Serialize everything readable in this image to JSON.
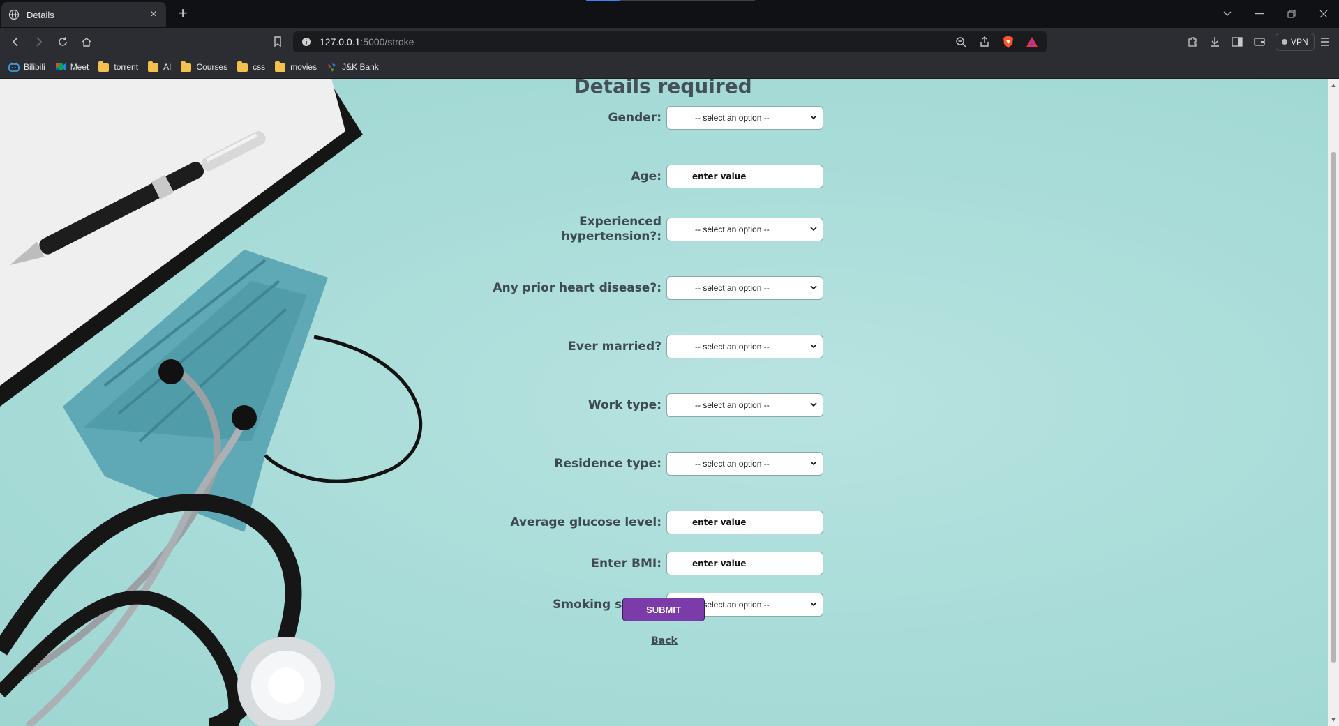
{
  "browser": {
    "tab_title": "Details",
    "url_host": "127.0.0.1",
    "url_path": ":5000/stroke",
    "vpn_label": "VPN",
    "bookmarks": [
      {
        "label": "Bilibili",
        "icon": "bilibili-icon"
      },
      {
        "label": "Meet",
        "icon": "meet-icon"
      },
      {
        "label": "torrent",
        "icon": "folder-icon"
      },
      {
        "label": "AI",
        "icon": "folder-icon"
      },
      {
        "label": "Courses",
        "icon": "folder-icon"
      },
      {
        "label": "css",
        "icon": "folder-icon"
      },
      {
        "label": "movies",
        "icon": "folder-icon"
      },
      {
        "label": "J&K Bank",
        "icon": "jk-bank-icon"
      }
    ]
  },
  "page": {
    "heading": "Details required",
    "fields": [
      {
        "label": "Gender:",
        "type": "select",
        "value": "-- select an option --"
      },
      {
        "label": "Age:",
        "type": "input",
        "placeholder": "enter value"
      },
      {
        "label": "Experienced hypertension?:",
        "type": "select",
        "value": "-- select an option --"
      },
      {
        "label": "Any prior heart disease?:",
        "type": "select",
        "value": "-- select an option --"
      },
      {
        "label": "Ever married?",
        "type": "select",
        "value": "-- select an option --"
      },
      {
        "label": "Work type:",
        "type": "select",
        "value": "-- select an option --"
      },
      {
        "label": "Residence type:",
        "type": "select",
        "value": "-- select an option --"
      },
      {
        "label": "Average glucose level:",
        "type": "input",
        "placeholder": "enter value"
      },
      {
        "label": "Enter BMI:",
        "type": "input",
        "placeholder": "enter value"
      },
      {
        "label": "Smoking status:",
        "type": "select",
        "value": "-- select an option --"
      }
    ],
    "submit_label": "SUBMIT",
    "back_label": "Back"
  },
  "colors": {
    "page_bg": "#a8dcd8",
    "submit_bg": "#7b3ba8",
    "label_text": "#3e4a52"
  }
}
